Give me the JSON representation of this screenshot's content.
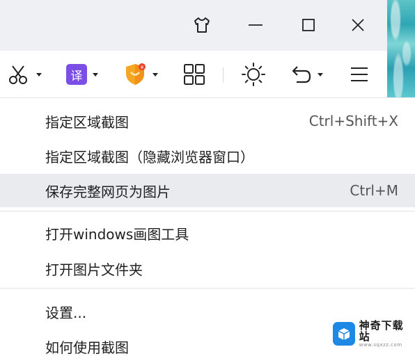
{
  "window_controls": {
    "skin_icon": "tshirt-icon",
    "minimize_icon": "minimize-icon",
    "maximize_icon": "maximize-icon",
    "close_icon": "close-icon"
  },
  "toolbar": {
    "screenshot_icon": "scissors-icon",
    "translate_label": "译",
    "security_icon": "shield-icon",
    "apps_icon": "grid-icon",
    "brightness_icon": "brightness-icon",
    "undo_icon": "undo-icon",
    "menu_icon": "hamburger-menu-icon"
  },
  "menu": {
    "items": [
      {
        "label": "指定区域截图",
        "shortcut": "Ctrl+Shift+X"
      },
      {
        "label": "指定区域截图（隐藏浏览器窗口）",
        "shortcut": ""
      },
      {
        "label": "保存完整网页为图片",
        "shortcut": "Ctrl+M"
      },
      {
        "label": "打开windows画图工具",
        "shortcut": ""
      },
      {
        "label": "打开图片文件夹",
        "shortcut": ""
      },
      {
        "label": "设置...",
        "shortcut": ""
      },
      {
        "label": "如何使用截图",
        "shortcut": ""
      }
    ]
  },
  "watermark": {
    "title": "神奇下载站",
    "subtitle": "www.sqxzz.com"
  },
  "colors": {
    "accent_purple": "#7b4ee6",
    "shield_orange": "#f5a623",
    "highlight_bg": "#e9ebef",
    "titlebar_bg": "#eef0f3"
  }
}
